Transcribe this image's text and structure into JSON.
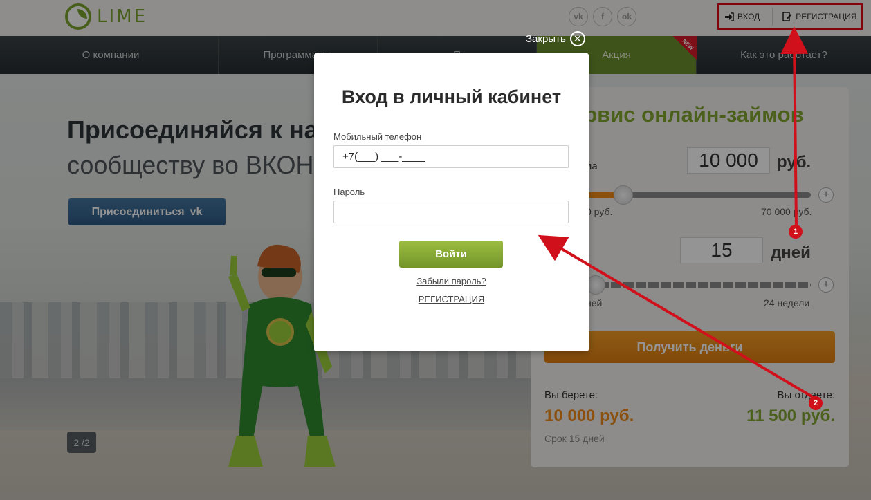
{
  "header": {
    "logo_text": "LIME",
    "social": [
      "vk-icon",
      "facebook-icon",
      "odnoklassniki-icon"
    ],
    "social_glyphs": [
      "vk",
      "f",
      "ok"
    ],
    "login_label": "ВХОД",
    "register_label": "РЕГИСТРАЦИЯ"
  },
  "nav": {
    "items": [
      {
        "label": "О компании"
      },
      {
        "label": "Программа ло"
      },
      {
        "label": "П"
      },
      {
        "label": "Акция",
        "badge": "NEW"
      },
      {
        "label": "Как это работает?"
      }
    ]
  },
  "hero": {
    "title": "Присоединяйся к на",
    "subtitle": "сообществу во ВКОН",
    "join_button": "Присоединиться",
    "join_icon": "vk",
    "slide_counter": "2 /2"
  },
  "calculator": {
    "title": "ервис онлайн-займов",
    "amount_label": "ма",
    "amount_value": "10 000",
    "amount_unit": "руб.",
    "amount_min": "0 руб.",
    "amount_max": "70 000 руб.",
    "term_label": "к",
    "term_value": "15",
    "term_unit": "дней",
    "term_min": "ней",
    "term_max": "24 недели",
    "get_money_button": "Получить деньги",
    "take_label": "Вы берете:",
    "take_value": "10 000 руб.",
    "return_label": "Вы отдаете:",
    "return_value": "11 500 руб.",
    "term_note": "Срок 15 дней",
    "colors": {
      "accent": "#82a52e",
      "orange": "#f08a18"
    }
  },
  "modal": {
    "close_label": "Закрыть",
    "title": "Вход в личный кабинет",
    "phone_label": "Мобильный телефон",
    "phone_value": "+7(___) ___-____",
    "password_label": "Пароль",
    "password_value": "",
    "login_button": "Войти",
    "forgot_link": "Забыли пароль?",
    "register_link": "РЕГИСТРАЦИЯ"
  },
  "annotations": {
    "badges": [
      "1",
      "2"
    ],
    "color": "#d0111b"
  }
}
